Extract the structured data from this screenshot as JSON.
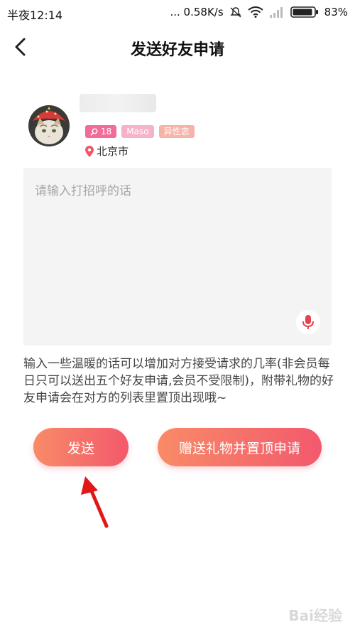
{
  "status_bar": {
    "time": "半夜12:14",
    "network_speed": "... 0.58K/s",
    "battery": "83%"
  },
  "header": {
    "title": "发送好友申请",
    "back_icon": "chevron-left-icon"
  },
  "profile": {
    "age": "18",
    "hobby_tag": "Maso",
    "orientation_tag": "异性恋",
    "location": "北京市"
  },
  "message": {
    "placeholder": "请输入打招呼的话",
    "mic_icon": "microphone-icon"
  },
  "hint": "输入一些温暖的话可以增加对方接受请求的几率(非会员每日只可以送出五个好友申请,会员不受限制)，附带礼物的好友申请会在对方的列表里置顶出现哦~",
  "buttons": {
    "send": "发送",
    "gift_top": "赠送礼物并置顶申请"
  },
  "colors": {
    "button_gradient_start": "#f88b67",
    "button_gradient_end": "#f3596d",
    "tag_pink": "#f26b9b",
    "mic_red": "#e8414f",
    "arrow_red": "#e01818"
  },
  "watermark": "Bai经验"
}
